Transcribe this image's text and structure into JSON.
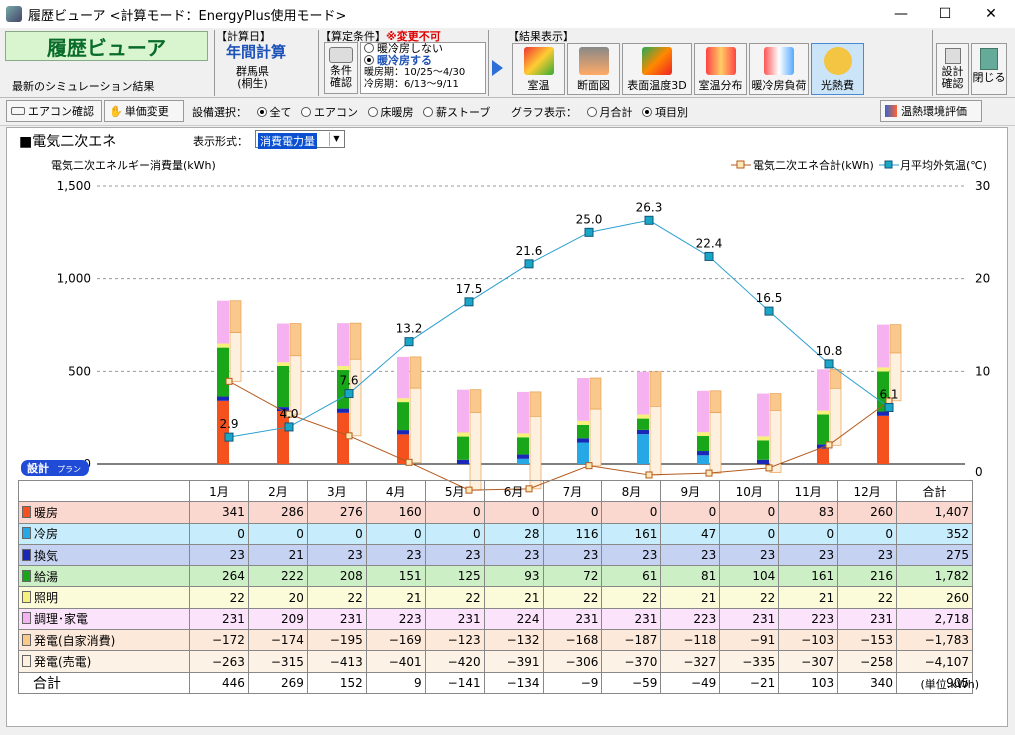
{
  "window": {
    "title": "履歴ビューア <計算モード：EnergyPlus使用モード>",
    "minimize": "—",
    "maximize": "☐",
    "close": "✕"
  },
  "ribbon": {
    "logo": "履歴ビューア",
    "latest": "最新のシミュレーション結果",
    "calc_day_label": "【計算日】",
    "calc_day_value": "年間計算",
    "location_pref": "群馬県",
    "location_city": "(桐生)",
    "cond_label": "【算定条件】",
    "cond_warning": "※変更不可",
    "cond_button": "条件確認",
    "radio_off": "暖冷房しない",
    "radio_on": "暖冷房する",
    "heat_period": "暖房期：10/25〜4/30",
    "cool_period": "冷房期：6/13〜9/11",
    "result_label": "【結果表示】",
    "tools": [
      {
        "label": "室温"
      },
      {
        "label": "断面図"
      },
      {
        "label": "表面温度3D"
      },
      {
        "label": "室温分布"
      },
      {
        "label": "暖冷房負荷"
      },
      {
        "label": "光熱費"
      }
    ],
    "design_button": "設計確認",
    "close_button": "閉じる"
  },
  "toolbar": {
    "aircon_button": "エアコン確認",
    "unitprice_button": "単価変更",
    "equip_label": "設備選択：",
    "equip_options": [
      "全て",
      "エアコン",
      "床暖房",
      "薪ストーブ"
    ],
    "graph_label": "グラフ表示：",
    "graph_options": [
      "月合計",
      "項目別"
    ],
    "thermal_button": "温熱環境評価"
  },
  "panel": {
    "title": "■電気二次エネ",
    "display_label": "表示形式：",
    "display_value": "消費電力量",
    "design_tag": "設計",
    "design_tag_sub": "プラン",
    "unit_note": "(単位:kWh)"
  },
  "chart_data": {
    "type": "bar",
    "ylabel_left": "電気二次エネルギー消費量(kWh)",
    "left_ticks": [
      "1,500",
      "1,000",
      "500",
      "0"
    ],
    "right_ticks": [
      "30",
      "20",
      "10",
      "0"
    ],
    "ylim_left": [
      0,
      1500
    ],
    "ylim_right": [
      0,
      30
    ],
    "categories": [
      "1月",
      "2月",
      "3月",
      "4月",
      "5月",
      "6月",
      "7月",
      "8月",
      "9月",
      "10月",
      "11月",
      "12月"
    ],
    "legend": [
      "電気二次エネ合計(kWh)",
      "月平均外気温(℃)"
    ],
    "series": [
      {
        "name": "暖房",
        "color": "#f4511e",
        "values": [
          341,
          286,
          276,
          160,
          0,
          0,
          0,
          0,
          0,
          0,
          83,
          260
        ]
      },
      {
        "name": "冷房",
        "color": "#26a7e6",
        "values": [
          0,
          0,
          0,
          0,
          0,
          28,
          116,
          161,
          47,
          0,
          0,
          0
        ]
      },
      {
        "name": "換気",
        "color": "#1a28b8",
        "values": [
          23,
          21,
          23,
          23,
          23,
          23,
          23,
          23,
          23,
          23,
          23,
          23
        ]
      },
      {
        "name": "給湯",
        "color": "#19a619",
        "values": [
          264,
          222,
          208,
          151,
          125,
          93,
          72,
          61,
          81,
          104,
          161,
          216
        ]
      },
      {
        "name": "照明",
        "color": "#f5f17a",
        "values": [
          22,
          20,
          22,
          21,
          22,
          21,
          22,
          22,
          21,
          22,
          21,
          22
        ]
      },
      {
        "name": "調理･家電",
        "color": "#f6b2f0",
        "values": [
          231,
          209,
          231,
          223,
          231,
          224,
          231,
          231,
          223,
          231,
          223,
          231
        ]
      },
      {
        "name": "発電(自家消費)",
        "color": "#f9c88c",
        "values": [
          -172,
          -174,
          -195,
          -169,
          -123,
          -132,
          -168,
          -187,
          -118,
          -91,
          -103,
          -153
        ]
      },
      {
        "name": "発電(売電)",
        "color": "#fdf0df",
        "values": [
          -263,
          -315,
          -413,
          -401,
          -420,
          -391,
          -306,
          -370,
          -327,
          -335,
          -307,
          -258
        ]
      }
    ],
    "total_line": [
      446,
      269,
      152,
      9,
      -141,
      -134,
      -9,
      -59,
      -49,
      -21,
      103,
      340
    ],
    "temperature": [
      2.9,
      4.0,
      7.6,
      13.2,
      17.5,
      21.6,
      25.0,
      26.3,
      22.4,
      16.5,
      10.8,
      6.1
    ],
    "temperature_labels": [
      "2.9",
      "4.0",
      "7.6",
      "13.2",
      "17.5",
      "21.6",
      "25.0",
      "26.3",
      "22.4",
      "16.5",
      "10.8",
      "6.1"
    ]
  },
  "table": {
    "headers": [
      "1月",
      "2月",
      "3月",
      "4月",
      "5月",
      "6月",
      "7月",
      "8月",
      "9月",
      "10月",
      "11月",
      "12月",
      "合計"
    ],
    "rows": [
      {
        "label": "暖房",
        "color": "#f4511e",
        "bg": "#fbd8cf",
        "cells": [
          "341",
          "286",
          "276",
          "160",
          "0",
          "0",
          "0",
          "0",
          "0",
          "0",
          "83",
          "260",
          "1,407"
        ]
      },
      {
        "label": "冷房",
        "color": "#26a7e6",
        "bg": "#c7ecfb",
        "cells": [
          "0",
          "0",
          "0",
          "0",
          "0",
          "28",
          "116",
          "161",
          "47",
          "0",
          "0",
          "0",
          "352"
        ]
      },
      {
        "label": "換気",
        "color": "#1a28b8",
        "bg": "#c6d2f2",
        "cells": [
          "23",
          "21",
          "23",
          "23",
          "23",
          "23",
          "23",
          "23",
          "23",
          "23",
          "23",
          "23",
          "275"
        ]
      },
      {
        "label": "給湯",
        "color": "#19a619",
        "bg": "#cdefc6",
        "cells": [
          "264",
          "222",
          "208",
          "151",
          "125",
          "93",
          "72",
          "61",
          "81",
          "104",
          "161",
          "216",
          "1,782"
        ]
      },
      {
        "label": "照明",
        "color": "#f5f17a",
        "bg": "#fcfbd9",
        "cells": [
          "22",
          "20",
          "22",
          "21",
          "22",
          "21",
          "22",
          "22",
          "21",
          "22",
          "21",
          "22",
          "260"
        ]
      },
      {
        "label": "調理･家電",
        "color": "#f6b2f0",
        "bg": "#fbe3fb",
        "cells": [
          "231",
          "209",
          "231",
          "223",
          "231",
          "224",
          "231",
          "231",
          "223",
          "231",
          "223",
          "231",
          "2,718"
        ]
      },
      {
        "label": "発電(自家消費)",
        "color": "#f9c88c",
        "bg": "#fde9d9",
        "cells": [
          "−172",
          "−174",
          "−195",
          "−169",
          "−123",
          "−132",
          "−168",
          "−187",
          "−118",
          "−91",
          "−103",
          "−153",
          "−1,783"
        ]
      },
      {
        "label": "発電(売電)",
        "color": "#fdf0df",
        "bg": "#fdf2e6",
        "cells": [
          "−263",
          "−315",
          "−413",
          "−401",
          "−420",
          "−391",
          "−306",
          "−370",
          "−327",
          "−335",
          "−307",
          "−258",
          "−4,107"
        ]
      }
    ],
    "total_label": "合計",
    "totals": [
      "446",
      "269",
      "152",
      "9",
      "−141",
      "−134",
      "−9",
      "−59",
      "−49",
      "−21",
      "103",
      "340",
      "905"
    ]
  }
}
